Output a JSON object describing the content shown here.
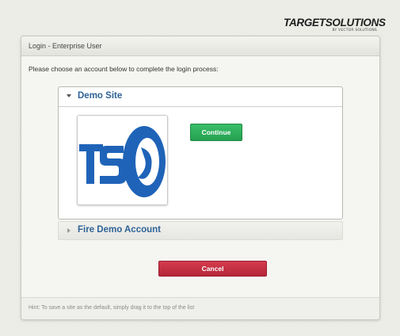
{
  "brand": {
    "name": "TARGETSOLUTIONS",
    "tagline": "BY VECTOR SOLUTIONS"
  },
  "login": {
    "title": "Login - Enterprise User",
    "instructions": "Please choose an account below to complete the login process:",
    "hint": "Hint: To save a site as the default, simply drag it to the top of the list",
    "cancel_label": "Cancel"
  },
  "accounts": [
    {
      "name": "Demo Site",
      "expanded": true,
      "logo_text": "TSO",
      "continue_label": "Continue"
    },
    {
      "name": "Fire Demo Account",
      "expanded": false
    }
  ],
  "colors": {
    "link_blue": "#2e6396",
    "continue_green": "#2daf5b",
    "cancel_red": "#c23143",
    "logo_blue": "#1f63b8"
  }
}
